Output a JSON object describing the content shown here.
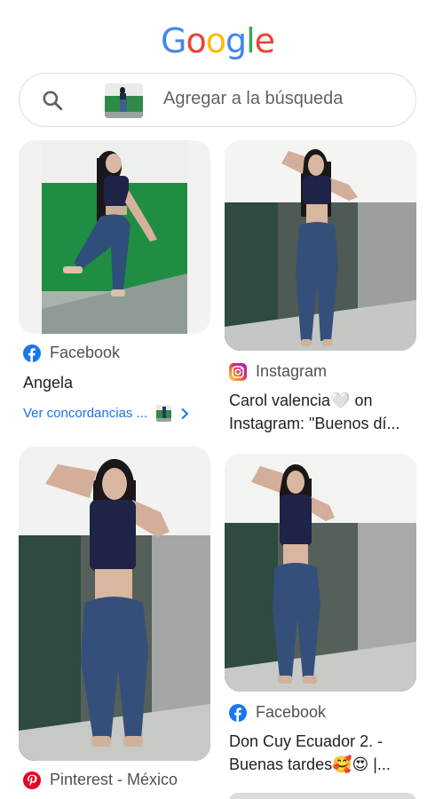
{
  "logo": {
    "letters": [
      "G",
      "o",
      "o",
      "g",
      "l",
      "e"
    ],
    "colors": [
      "#4285F4",
      "#EA4335",
      "#FBBC05",
      "#4285F4",
      "#34A853",
      "#EA4335"
    ]
  },
  "search": {
    "placeholder": "Agregar a la búsqueda",
    "icon": "search-icon"
  },
  "results": [
    {
      "source": "Facebook",
      "source_icon": "facebook-icon",
      "title": "Angela",
      "match_link": "Ver concordancias ..."
    },
    {
      "source": "Instagram",
      "source_icon": "instagram-icon",
      "title": "Carol valencia🤍 on Instagram: \"Buenos dí..."
    },
    {
      "source": "Pinterest - México",
      "source_icon": "pinterest-icon",
      "title": ""
    },
    {
      "source": "Facebook",
      "source_icon": "facebook-icon",
      "title": "Don Cuy Ecuador 2. - Buenas tardes🥰😍 |..."
    }
  ]
}
